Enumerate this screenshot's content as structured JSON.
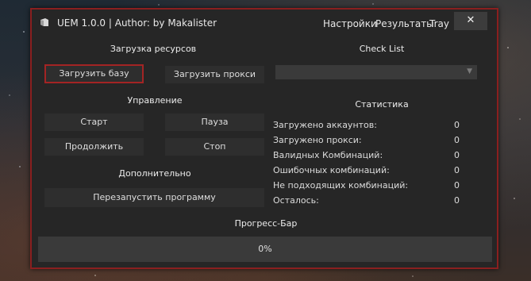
{
  "window": {
    "title": "UEM 1.0.0 | Author: by Makalister",
    "menu": [
      "Настройки",
      "Результаты",
      "Tray"
    ],
    "close_label": "✕"
  },
  "resources": {
    "title": "Загрузка ресурсов",
    "load_base": "Загрузить базу",
    "load_proxy": "Загрузить прокси"
  },
  "checklist": {
    "title": "Check List",
    "selected": ""
  },
  "control": {
    "title": "Управление",
    "start": "Старт",
    "pause": "Пауза",
    "resume": "Продолжить",
    "stop": "Стоп"
  },
  "extra": {
    "title": "Дополнительно",
    "restart": "Перезапустить программу"
  },
  "stats": {
    "title": "Статистика",
    "rows": [
      {
        "label": "Загружено аккаунтов:",
        "value": "0"
      },
      {
        "label": "Загружено прокси:",
        "value": "0"
      },
      {
        "label": "Валидных Комбинаций:",
        "value": "0"
      },
      {
        "label": "Ошибочных комбинаций:",
        "value": "0"
      },
      {
        "label": "Не подходящих комбинаций:",
        "value": "0"
      },
      {
        "label": "Осталось:",
        "value": "0"
      }
    ]
  },
  "progress": {
    "title": "Прогресс-Бар",
    "value_text": "0%",
    "value": 0
  },
  "colors": {
    "accent": "#8a1f1f",
    "window_bg": "#262626",
    "button_bg": "#2e2e2e"
  }
}
